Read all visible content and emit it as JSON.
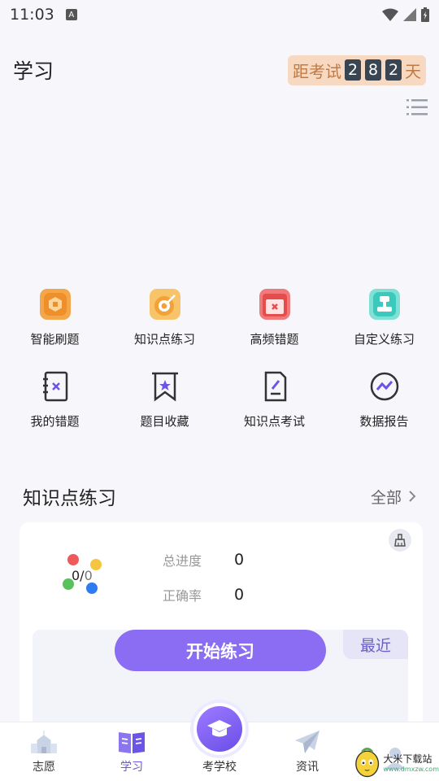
{
  "status_bar": {
    "time": "11:03",
    "a_label": "A"
  },
  "header": {
    "title": "学习",
    "countdown_prefix": "距考试",
    "countdown_digits": [
      "2",
      "8",
      "2"
    ],
    "countdown_suffix": "天"
  },
  "grid": [
    {
      "label": "智能刷题",
      "icon": "smart-practice-icon",
      "color": "#f19a3e"
    },
    {
      "label": "知识点练习",
      "icon": "target-icon",
      "color": "#f3a63b"
    },
    {
      "label": "高频错题",
      "icon": "calendar-error-icon",
      "color": "#ea5454"
    },
    {
      "label": "自定义练习",
      "icon": "stamp-icon",
      "color": "#3cc9bd"
    },
    {
      "label": "我的错题",
      "icon": "error-book-icon",
      "color": "#333333"
    },
    {
      "label": "题目收藏",
      "icon": "bookmark-icon",
      "color": "#333333"
    },
    {
      "label": "知识点考试",
      "icon": "exam-paper-icon",
      "color": "#333333"
    },
    {
      "label": "数据报告",
      "icon": "report-icon",
      "color": "#333333"
    }
  ],
  "section": {
    "title": "知识点练习",
    "see_all": "全部"
  },
  "card": {
    "ratio_num": "0/",
    "ratio_den": "0",
    "progress_label": "总进度",
    "progress_value": "0",
    "accuracy_label": "正确率",
    "accuracy_value": "0",
    "recent_label": "最近",
    "start_label": "开始练习"
  },
  "nav": [
    {
      "label": "志愿"
    },
    {
      "label": "学习"
    },
    {
      "label": "考学校"
    },
    {
      "label": "资讯"
    },
    {
      "label": ""
    }
  ],
  "watermark": {
    "title": "大米下载站",
    "url": "www.dmxzw.com"
  },
  "colors": {
    "accent": "#8a6df2",
    "active_nav": "#6a55e6"
  }
}
